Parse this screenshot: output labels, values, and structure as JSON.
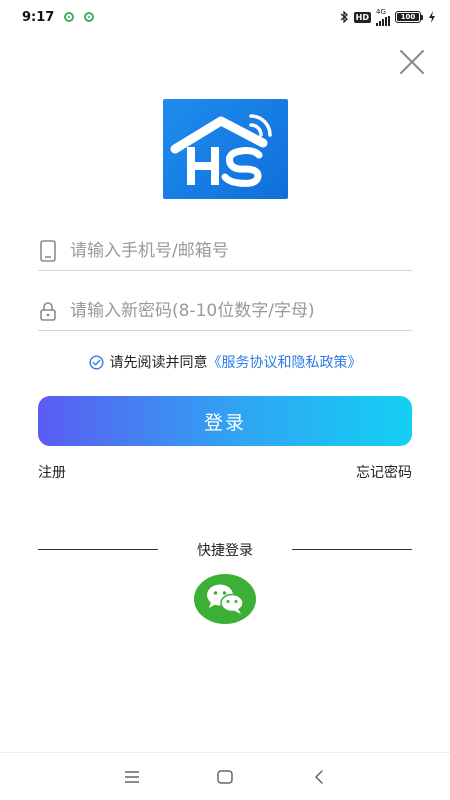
{
  "status_bar": {
    "time": "9:17",
    "network": "4G",
    "hd": "HD",
    "battery": "100",
    "icons": [
      "bluetooth-icon",
      "hd-icon",
      "signal-icon",
      "battery-icon",
      "charging-icon"
    ]
  },
  "login": {
    "close_icon": "close-icon",
    "phone_placeholder": "请输入手机号/邮箱号",
    "password_placeholder": "请输入新密码(8-10位数字/字母)",
    "agreement_prefix": "请先阅读并同意",
    "agreement_link": "《服务协议和隐私政策》",
    "login_label": "登录",
    "register_label": "注册",
    "forgot_label": "忘记密码",
    "quick_login_title": "快捷登录"
  },
  "colors": {
    "accent_blue": "#2e7ce6",
    "logo_blue": "#1f8cf0",
    "wechat_green": "#3cb034",
    "button_gradient_start": "#5b5cf2",
    "button_gradient_end": "#14d0f4"
  },
  "nav_bar": {
    "icons": [
      "menu-icon",
      "home-icon",
      "back-icon"
    ]
  }
}
